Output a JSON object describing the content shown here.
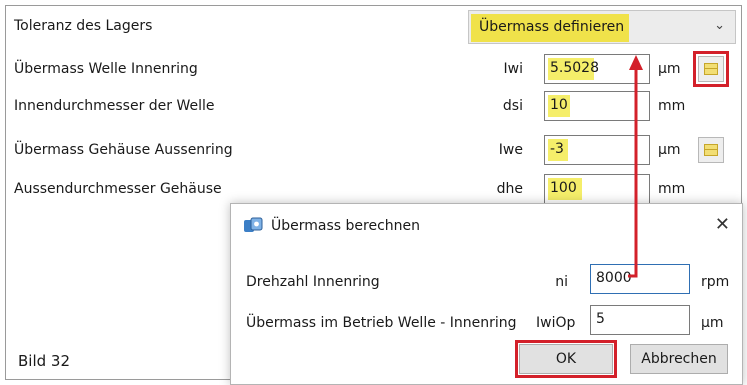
{
  "form": {
    "tolerance_label": "Toleranz des Lagers",
    "tolerance_value": "Übermass definieren",
    "rows": [
      {
        "label": "Übermass Welle Innenring",
        "symbol": "Iwi",
        "value": "5.5028",
        "unit": "µm"
      },
      {
        "label": "Innendurchmesser der Welle",
        "symbol": "dsi",
        "value": "10",
        "unit": "mm"
      },
      {
        "label": "Übermass Gehäuse Aussenring",
        "symbol": "Iwe",
        "value": "-3",
        "unit": "µm"
      },
      {
        "label": "Aussendurchmesser Gehäuse",
        "symbol": "dhe",
        "value": "100",
        "unit": "mm"
      }
    ]
  },
  "dialog": {
    "title": "Übermass berechnen",
    "close_glyph": "✕",
    "rows": [
      {
        "label": "Drehzahl Innenring",
        "symbol": "ni",
        "value": "8000",
        "unit": "rpm"
      },
      {
        "label": "Übermass im Betrieb Welle - Innenring",
        "symbol": "IwiOp",
        "value": "5",
        "unit": "µm"
      }
    ],
    "ok_label": "OK",
    "cancel_label": "Abbrechen"
  },
  "caption": "Bild 32",
  "icons": {
    "dropdown": "chevron-down-icon",
    "calculate": "calculator-icon",
    "dialog": "app-icon",
    "close": "close-icon"
  },
  "colors": {
    "highlight": "#f5ee6a",
    "annotation_red": "#d3202a"
  }
}
